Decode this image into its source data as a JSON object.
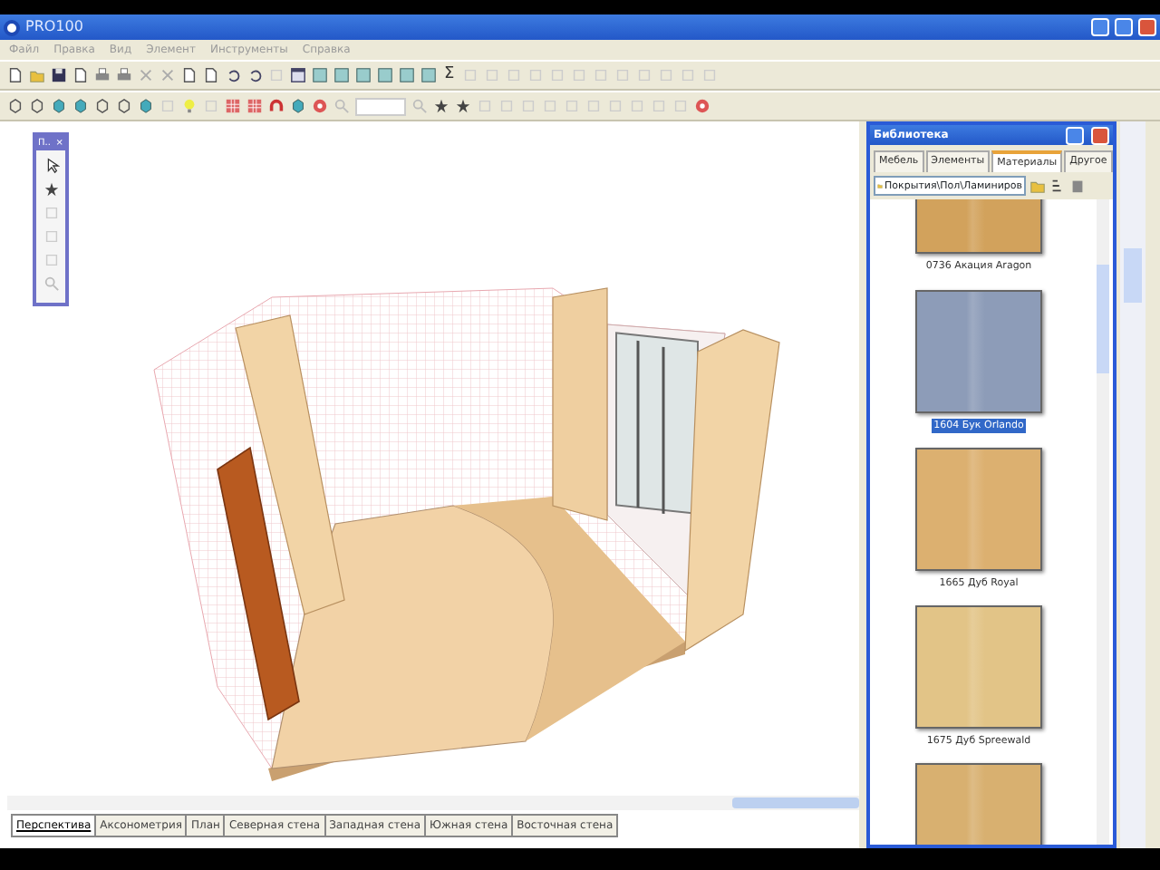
{
  "window": {
    "title": "PRO100"
  },
  "menu": [
    "Файл",
    "Правка",
    "Вид",
    "Элемент",
    "Инструменты",
    "Справка"
  ],
  "toolbar": {
    "sum_button": "Σ"
  },
  "toolbox": {
    "title": "П..",
    "close": "×"
  },
  "library": {
    "title": "Библиотека",
    "tabs": [
      {
        "label": "Мебель",
        "selected": false
      },
      {
        "label": "Элементы",
        "selected": false
      },
      {
        "label": "Материалы",
        "selected": true
      },
      {
        "label": "Другое",
        "selected": false
      }
    ],
    "path": "Покрытия\\Пол\\Ламиниров",
    "materials": [
      {
        "label": "0736 Акация Aragon",
        "color": "#d2a25c",
        "selected": false
      },
      {
        "label": "1604 Бук Orlando",
        "color": "#8d9cb8",
        "selected": true
      },
      {
        "label": "1665 Дуб Royal",
        "color": "#dcb070",
        "selected": false
      },
      {
        "label": "1675 Дуб Spreewald",
        "color": "#e2c487",
        "selected": false
      },
      {
        "color": "#d8b070",
        "selected": false
      }
    ]
  },
  "view_tabs": [
    {
      "label": "Перспектива",
      "selected": true
    },
    {
      "label": "Аксонометрия",
      "selected": false
    },
    {
      "label": "План",
      "selected": false
    },
    {
      "label": "Северная стена",
      "selected": false
    },
    {
      "label": "Западная стена",
      "selected": false
    },
    {
      "label": "Южная стена",
      "selected": false
    },
    {
      "label": "Восточная стена",
      "selected": false
    }
  ]
}
